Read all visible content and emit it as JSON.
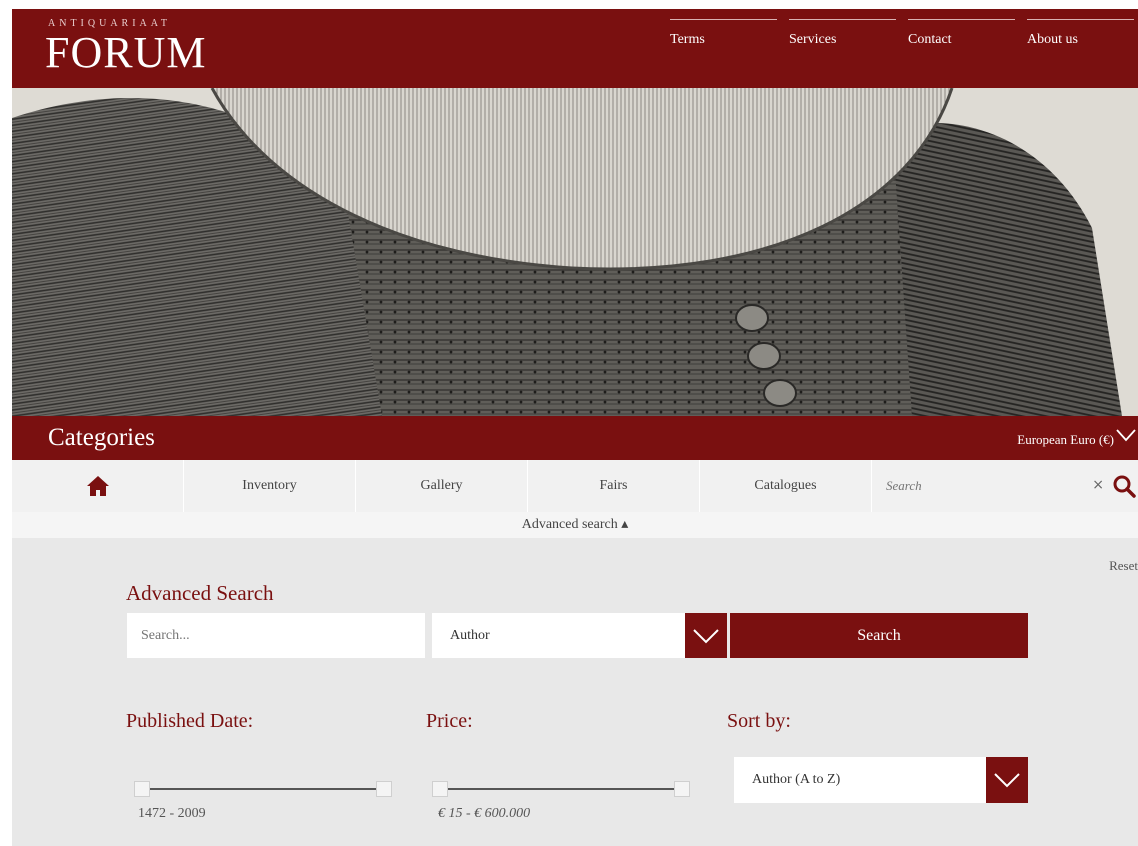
{
  "header": {
    "logo_small": "ANTIQUARIAAT",
    "logo_big": "FORUM",
    "nav": [
      {
        "label": "Terms"
      },
      {
        "label": "Services"
      },
      {
        "label": "Contact"
      },
      {
        "label": "About us"
      }
    ]
  },
  "categories_bar": {
    "title": "Categories",
    "currency": "European Euro (€)"
  },
  "menu": {
    "items": [
      {
        "label": "Inventory"
      },
      {
        "label": "Gallery"
      },
      {
        "label": "Fairs"
      },
      {
        "label": "Catalogues"
      }
    ],
    "search_placeholder": "Search",
    "clear_symbol": "×"
  },
  "advanced_toggle": "Advanced search ▴",
  "advanced": {
    "reset": "Reset",
    "title": "Advanced Search",
    "search_placeholder": "Search...",
    "field_selected": "Author",
    "search_button": "Search",
    "published_label": "Published Date:",
    "published_range": "1472 - 2009",
    "price_label": "Price:",
    "price_range": "€ 15 - € 600.000",
    "sort_label": "Sort by:",
    "sort_selected": "Author (A to Z)"
  },
  "colors": {
    "brand": "#7a1010",
    "panel": "#e8e8e8"
  },
  "icons": {
    "home": "home-icon",
    "search": "search-icon",
    "chevron": "chevron-down-icon"
  }
}
